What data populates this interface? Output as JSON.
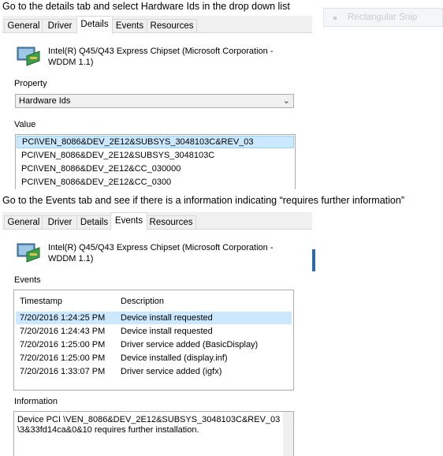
{
  "caption1": "Go to the details tab and select Hardware Ids in the drop down list",
  "caption2": "Go to the Events tab and see if there is a information indicating “requires further information”",
  "snip": {
    "label": "Rectangular Snip"
  },
  "panel1": {
    "tabs": [
      "General",
      "Driver",
      "Details",
      "Events",
      "Resources"
    ],
    "active_tab": "Details",
    "device_name": "Intel(R) Q45/Q43 Express Chipset (Microsoft Corporation - WDDM 1.1)",
    "property_label": "Property",
    "property_value": "Hardware Ids",
    "value_label": "Value",
    "values": [
      "PCI\\VEN_8086&DEV_2E12&SUBSYS_3048103C&REV_03",
      "PCI\\VEN_8086&DEV_2E12&SUBSYS_3048103C",
      "PCI\\VEN_8086&DEV_2E12&CC_030000",
      "PCI\\VEN_8086&DEV_2E12&CC_0300"
    ]
  },
  "panel2": {
    "tabs": [
      "General",
      "Driver",
      "Details",
      "Events",
      "Resources"
    ],
    "active_tab": "Events",
    "device_name": "Intel(R) Q45/Q43 Express Chipset (Microsoft Corporation - WDDM 1.1)",
    "events_label": "Events",
    "col_timestamp": "Timestamp",
    "col_description": "Description",
    "events": [
      {
        "ts": "7/20/2016 1:24:25 PM",
        "desc": "Device install requested"
      },
      {
        "ts": "7/20/2016 1:24:43 PM",
        "desc": "Device install requested"
      },
      {
        "ts": "7/20/2016 1:25:00 PM",
        "desc": "Driver service added (BasicDisplay)"
      },
      {
        "ts": "7/20/2016 1:25:00 PM",
        "desc": "Device installed (display.inf)"
      },
      {
        "ts": "7/20/2016 1:33:07 PM",
        "desc": "Driver service added (igfx)"
      }
    ],
    "information_label": "Information",
    "information_text": "Device PCI \\VEN_8086&DEV_2E12&SUBSYS_3048103C&REV_03\\3&33fd14ca&0&10 requires further installation."
  }
}
